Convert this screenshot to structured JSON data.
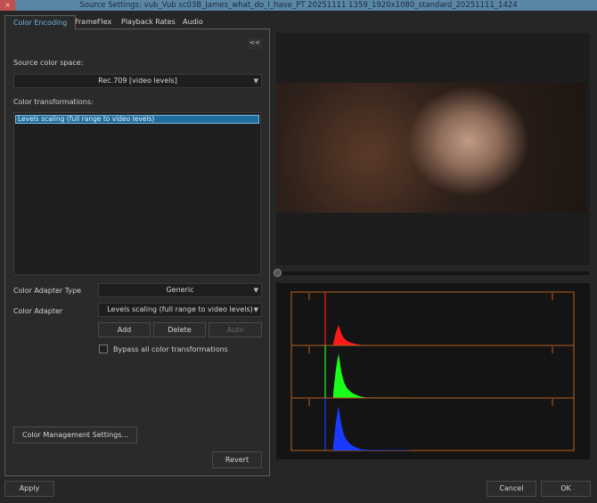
{
  "window": {
    "title": "Source Settings: vub_Vub sc03B_James_what_do_I_have_PT 20251111 1359_1920x1080_standard_20251111_1424",
    "close": "×"
  },
  "tabs": [
    {
      "label": "Color Encoding",
      "active": true
    },
    {
      "label": "FrameFlex"
    },
    {
      "label": "Playback Rates"
    },
    {
      "label": "Audio"
    }
  ],
  "panel": {
    "collapse": "<<",
    "source_label": "Source color space:",
    "source_value": "Rec.709 [video levels]",
    "transforms_label": "Color transformations:",
    "transforms": [
      "Levels scaling (full range to video levels)"
    ],
    "adapter_type_label": "Color Adapter Type",
    "adapter_type_value": "Generic",
    "adapter_label": "Color Adapter",
    "adapter_value": "Levels scaling (full range to video levels)",
    "add": "Add",
    "delete": "Delete",
    "auto": "Auto",
    "bypass_label": "Bypass all color transformations",
    "bypass_checked": false,
    "cms": "Color Management Settings...",
    "revert": "Revert"
  },
  "footer": {
    "apply": "Apply",
    "cancel": "Cancel",
    "ok": "OK"
  },
  "histogram": {
    "colors": {
      "red": "#ff1a1a",
      "green": "#1aff1a",
      "blue": "#1a3aff",
      "frame": "#b8601e"
    }
  }
}
